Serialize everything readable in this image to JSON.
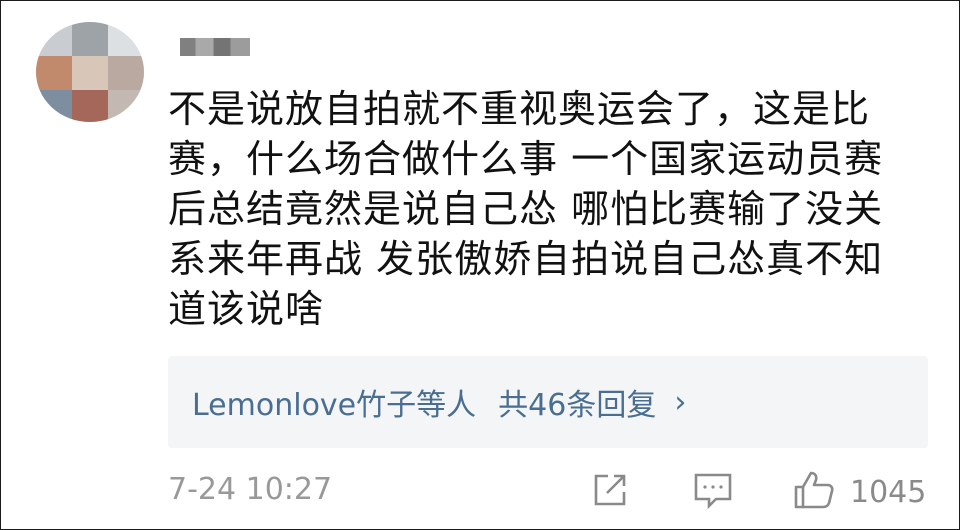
{
  "comment": {
    "username": "",
    "text": "不是说放自拍就不重视奥运会了，这是比\n赛，什么场合做什么事 一个国家运动员赛\n后总结竟然是说自己怂 哪怕比赛输了没关\n系来年再战 发张傲娇自拍说自己怂真不知\n道该说啥",
    "time": "7-24 10:27"
  },
  "replies": {
    "users": "Lemonlove竹子等人",
    "count_label": "共46条回复",
    "chevron": "›"
  },
  "actions": {
    "like_count": "1045",
    "share_icon": "share-icon",
    "reply_icon": "comment-icon",
    "like_icon": "thumbs-up-icon"
  }
}
